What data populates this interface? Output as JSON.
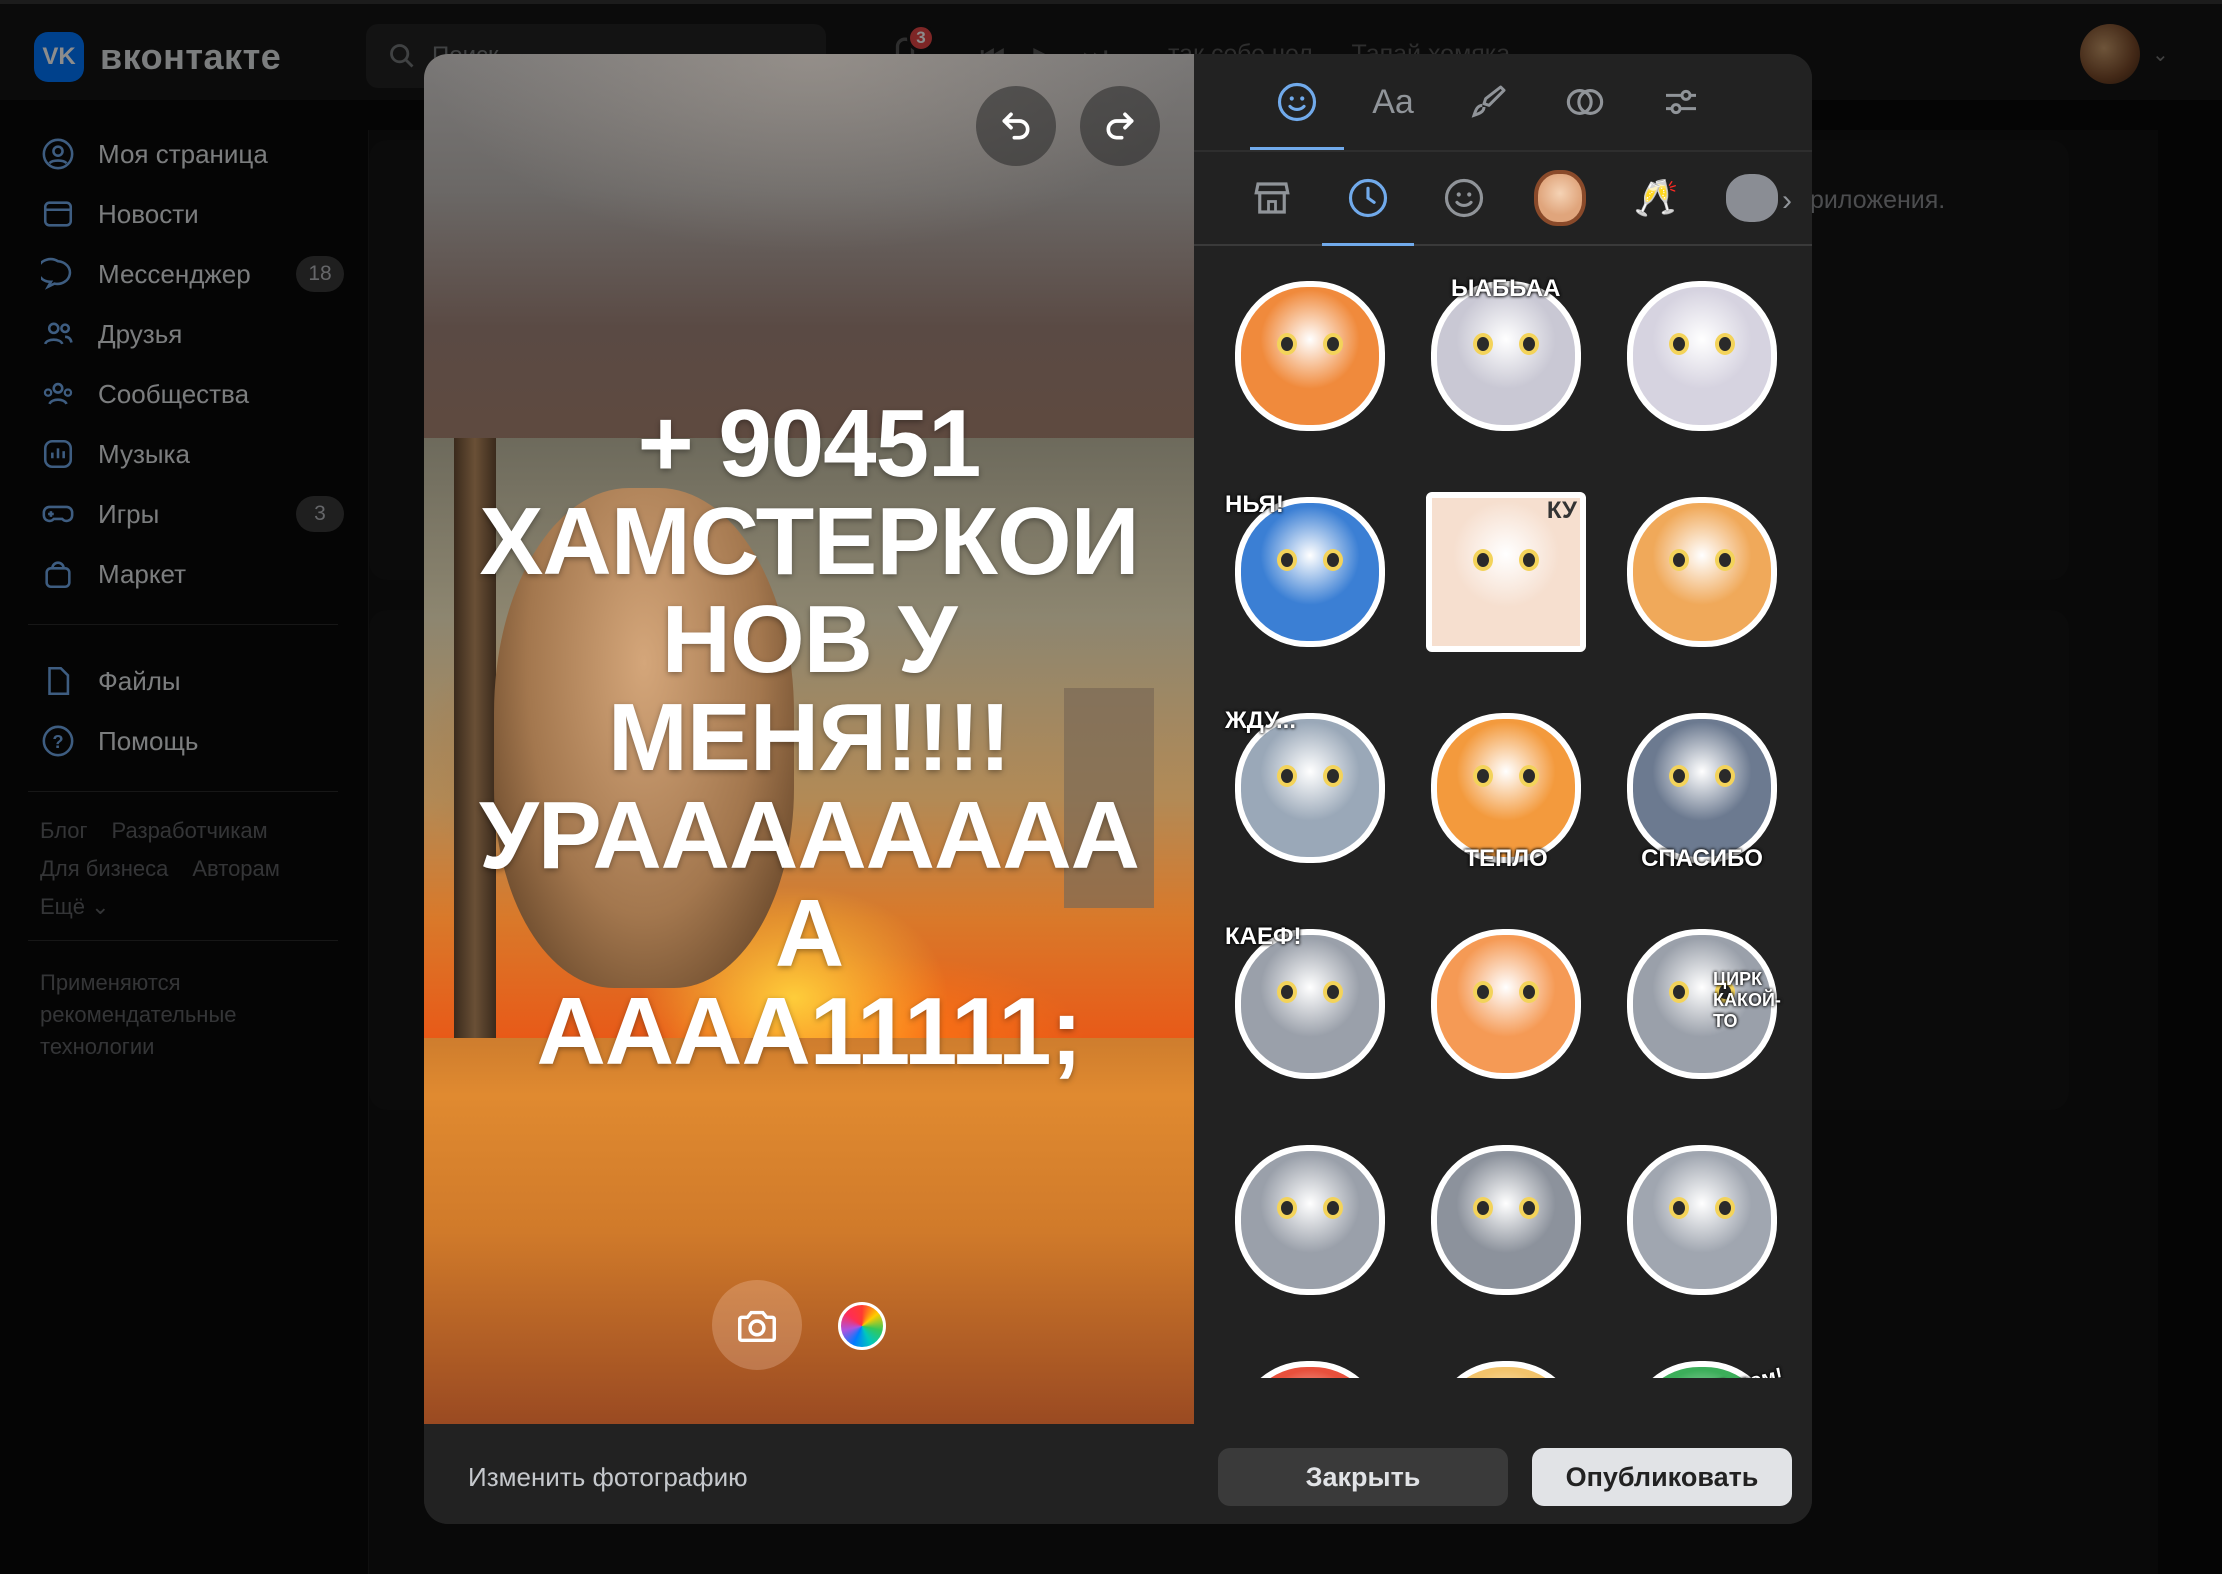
{
  "header": {
    "logo_text": "вконтакте",
    "search_placeholder": "Поиск",
    "notifications_count": "3",
    "now_playing": "так себе чел — Тапай хомяка"
  },
  "sidebar": {
    "items": [
      {
        "label": "Моя страница",
        "icon": "user-circle-icon"
      },
      {
        "label": "Новости",
        "icon": "news-icon"
      },
      {
        "label": "Мессенджер",
        "icon": "chat-icon",
        "count": "18"
      },
      {
        "label": "Друзья",
        "icon": "friends-icon"
      },
      {
        "label": "Сообщества",
        "icon": "communities-icon"
      },
      {
        "label": "Музыка",
        "icon": "music-icon"
      },
      {
        "label": "Игры",
        "icon": "gamepad-icon",
        "count": "3"
      },
      {
        "label": "Маркет",
        "icon": "bag-icon"
      }
    ],
    "secondary": [
      {
        "label": "Файлы",
        "icon": "file-icon"
      },
      {
        "label": "Помощь",
        "icon": "help-icon"
      }
    ],
    "footer_links": [
      "Блог",
      "Разработчикам",
      "Для бизнеса",
      "Авторам",
      "Ещё"
    ],
    "footer_note": "Применяются рекомендательные технологии"
  },
  "background": {
    "hint_text": "риложения."
  },
  "editor": {
    "story_text": "+ 90451\nХАМСТЕРКОИ\nНОВ У\nМЕНЯ!!!!\nУРААААААААА\nАААА11111;",
    "tool_tabs": [
      {
        "name": "stickers",
        "icon": "smile-icon",
        "active": true
      },
      {
        "name": "text",
        "label": "Aa",
        "active": false
      },
      {
        "name": "draw",
        "icon": "brush-icon",
        "active": false
      },
      {
        "name": "filters",
        "icon": "filters-icon",
        "active": false
      },
      {
        "name": "adjust",
        "icon": "sliders-icon",
        "active": false
      }
    ],
    "sticker_categories": [
      {
        "name": "store",
        "icon": "store-icon"
      },
      {
        "name": "recent",
        "icon": "clock-icon",
        "active": true
      },
      {
        "name": "emoji",
        "icon": "smile-icon"
      },
      {
        "name": "avatar",
        "icon": "avatar-face-icon"
      },
      {
        "name": "cheers",
        "icon": "cheers-icon"
      },
      {
        "name": "cat-pack",
        "icon": "cat-sticker-icon"
      }
    ],
    "stickers": [
      {
        "name": "fox-with-flowers",
        "label": "",
        "color": "#f08a3c"
      },
      {
        "name": "seal-ыабьаа",
        "label": "ЫАБЬАА",
        "color": "#c9c8d4"
      },
      {
        "name": "seal-shy",
        "label": "",
        "color": "#d6d3e0"
      },
      {
        "name": "shark-nya",
        "label": "НЬЯ!",
        "color": "#3b7fd4"
      },
      {
        "name": "anime-girl-ku",
        "label": "КУ",
        "color": "#f6dfcf"
      },
      {
        "name": "cat-hug",
        "label": "",
        "color": "#f0a95a"
      },
      {
        "name": "seal-zhdu",
        "label": "ЖДУ...",
        "color": "#9aa8b8"
      },
      {
        "name": "corgi-teplo",
        "label": "ТЕПЛО",
        "color": "#f39a3d"
      },
      {
        "name": "raccoon-spasibo",
        "label": "СПАСИБО",
        "color": "#6c7a90"
      },
      {
        "name": "cat-kaef",
        "label": "КАЕФ!",
        "color": "#9aa0aa"
      },
      {
        "name": "cat-kiss",
        "label": "",
        "color": "#f59a55"
      },
      {
        "name": "cat-circus",
        "label": "ЦИРК КАКОЙ-ТО",
        "color": "#9aa0aa"
      },
      {
        "name": "cat-shocked",
        "label": "",
        "color": "#9aa0aa"
      },
      {
        "name": "cat-thumbs-up",
        "label": "",
        "color": "#8c929c"
      },
      {
        "name": "cat-gamer",
        "label": "",
        "color": "#a0a6b0"
      },
      {
        "name": "girl-frame",
        "label": "",
        "color": "#e8503c"
      },
      {
        "name": "cow-sunglasses",
        "label": "",
        "color": "#f2c36b"
      },
      {
        "name": "new-year",
        "label": "С Новым Годом!",
        "color": "#3cae5a"
      }
    ],
    "footer": {
      "change_photo": "Изменить фотографию",
      "close": "Закрыть",
      "publish": "Опубликовать"
    }
  }
}
